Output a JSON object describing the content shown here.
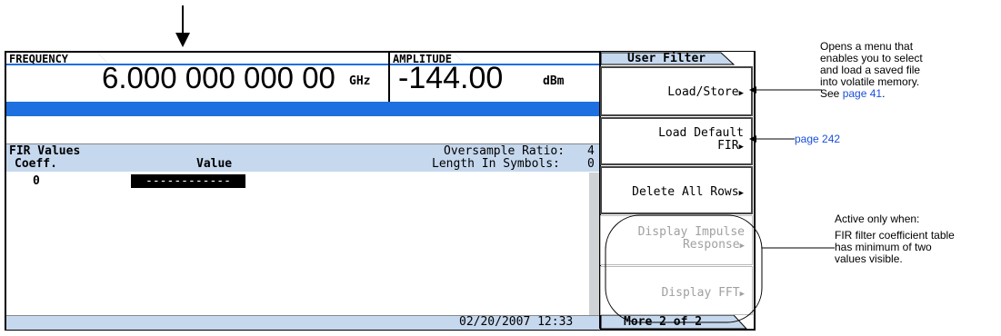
{
  "frequency": {
    "label": "FREQUENCY",
    "value": "6.000 000 000 00",
    "unit": "GHz"
  },
  "amplitude": {
    "label": "AMPLITUDE",
    "value": "-144.00",
    "unit": "dBm"
  },
  "table": {
    "title": "FIR Values",
    "col_coeff": "Coeff.",
    "col_value": "Value",
    "oversample_label": "Oversample Ratio:",
    "oversample_value": "4",
    "length_label": "Length In Symbols:",
    "length_value": "0",
    "rows": [
      {
        "coeff": "0",
        "value": "------------"
      }
    ]
  },
  "status": {
    "datetime": "02/20/2007 12:33"
  },
  "menu": {
    "title": "User Filter",
    "load_store": "Load/Store",
    "load_default_1": "Load Default",
    "load_default_2": "FIR",
    "delete_all": "Delete All Rows",
    "display_impulse_1": "Display Impulse",
    "display_impulse_2": "Response",
    "display_fft": "Display FFT",
    "more": "More 2 of 2"
  },
  "annotations": {
    "load_store_note_1": "Opens a menu that",
    "load_store_note_2": "enables you to select",
    "load_store_note_3": "and load a saved file",
    "load_store_note_4": "into volatile memory.",
    "load_store_note_5": "See",
    "load_store_link": "page 41",
    "load_default_link": "page 242",
    "active_note_1": "Active only when:",
    "active_note_2": "FIR filter coefficient table",
    "active_note_3": "has minimum of two",
    "active_note_4": "values visible."
  },
  "colors": {
    "accent_blue": "#1e6fe0",
    "light_blue": "#c6d8ee",
    "disabled": "#a0a0a0"
  }
}
